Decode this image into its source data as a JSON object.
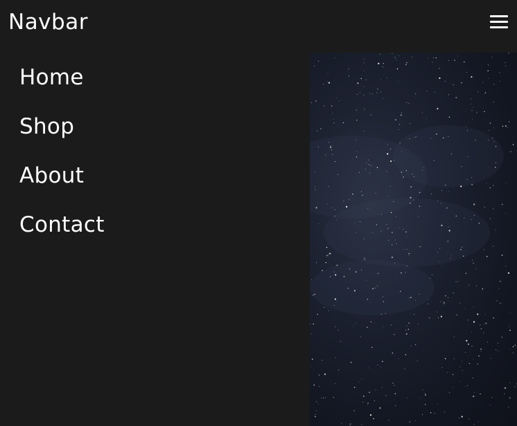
{
  "header": {
    "brand": "Navbar",
    "menu_icon": "hamburger-menu-icon"
  },
  "nav": {
    "items": [
      {
        "label": "Home"
      },
      {
        "label": "Shop"
      },
      {
        "label": "About"
      },
      {
        "label": "Contact"
      }
    ]
  },
  "hero": {
    "image": "starry-night-sky"
  },
  "colors": {
    "background": "#1b1b1b",
    "text": "#ffffff",
    "sky": "#1c2130"
  }
}
